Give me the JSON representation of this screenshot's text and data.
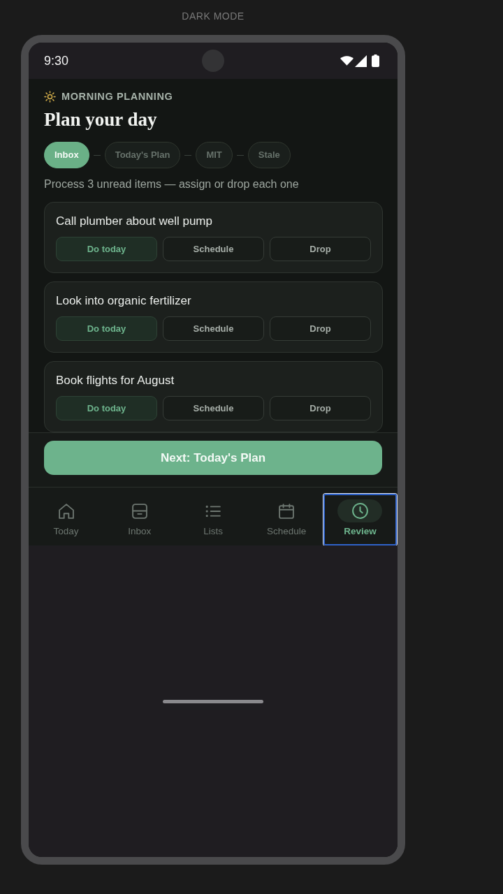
{
  "page_label": "DARK MODE",
  "status_bar": {
    "time": "9:30"
  },
  "header": {
    "eyebrow": "MORNING PLANNING",
    "title": "Plan your day"
  },
  "steps": [
    {
      "label": "Inbox",
      "selected": true
    },
    {
      "label": "Today's Plan",
      "selected": false
    },
    {
      "label": "MIT",
      "selected": false
    },
    {
      "label": "Stale",
      "selected": false
    }
  ],
  "instruction": "Process 3 unread items — assign or drop each one",
  "tasks": [
    {
      "title": "Call plumber about well pump",
      "actions": [
        {
          "label": "Do today",
          "kind": "primary"
        },
        {
          "label": "Schedule",
          "kind": "secondary"
        },
        {
          "label": "Drop",
          "kind": "secondary"
        }
      ]
    },
    {
      "title": "Look into organic fertilizer",
      "actions": [
        {
          "label": "Do today",
          "kind": "primary"
        },
        {
          "label": "Schedule",
          "kind": "secondary"
        },
        {
          "label": "Drop",
          "kind": "secondary"
        }
      ]
    },
    {
      "title": "Book flights for August",
      "actions": [
        {
          "label": "Do today",
          "kind": "primary"
        },
        {
          "label": "Schedule",
          "kind": "secondary"
        },
        {
          "label": "Drop",
          "kind": "secondary"
        }
      ]
    }
  ],
  "next_button": {
    "label": "Next: Today's Plan"
  },
  "bottom_nav": [
    {
      "label": "Today",
      "selected": false,
      "focused": false
    },
    {
      "label": "Inbox",
      "selected": false,
      "focused": false
    },
    {
      "label": "Lists",
      "selected": false,
      "focused": false
    },
    {
      "label": "Schedule",
      "selected": false,
      "focused": false
    },
    {
      "label": "Review",
      "selected": true,
      "focused": true
    }
  ]
}
